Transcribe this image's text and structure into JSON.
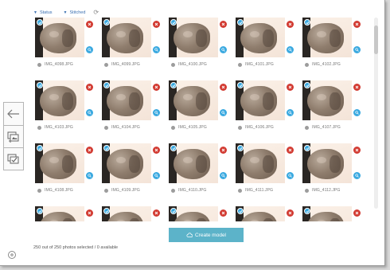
{
  "filters": [
    {
      "label": "Status"
    },
    {
      "label": "Stitched"
    }
  ],
  "photos": [
    "IMG_4098.JPG",
    "IMG_4099.JPG",
    "IMG_4100.JPG",
    "IMG_4101.JPG",
    "IMG_4102.JPG",
    "IMG_4103.JPG",
    "IMG_4104.JPG",
    "IMG_4105.JPG",
    "IMG_4106.JPG",
    "IMG_4107.JPG",
    "IMG_4108.JPG",
    "IMG_4109.JPG",
    "IMG_4110.JPG",
    "IMG_4111.JPG",
    "IMG_4112.JPG",
    "",
    "",
    "",
    "",
    ""
  ],
  "footer": {
    "create_label": "Create model",
    "selection_status": "250 out of 250 photos selected / 0 available"
  },
  "colors": {
    "accent": "#5cb3c9",
    "check": "#3aa9e0",
    "remove": "#d23b32"
  },
  "icons": {
    "filter_caret": "caret-down-icon",
    "refresh": "refresh-icon",
    "back": "arrow-left-icon",
    "add_photos": "add-photos-icon",
    "select_photos": "select-photos-icon",
    "selected": "check-icon",
    "remove": "close-icon",
    "zoom": "magnifier-icon",
    "create": "cloud-upload-icon",
    "help": "help-icon"
  }
}
